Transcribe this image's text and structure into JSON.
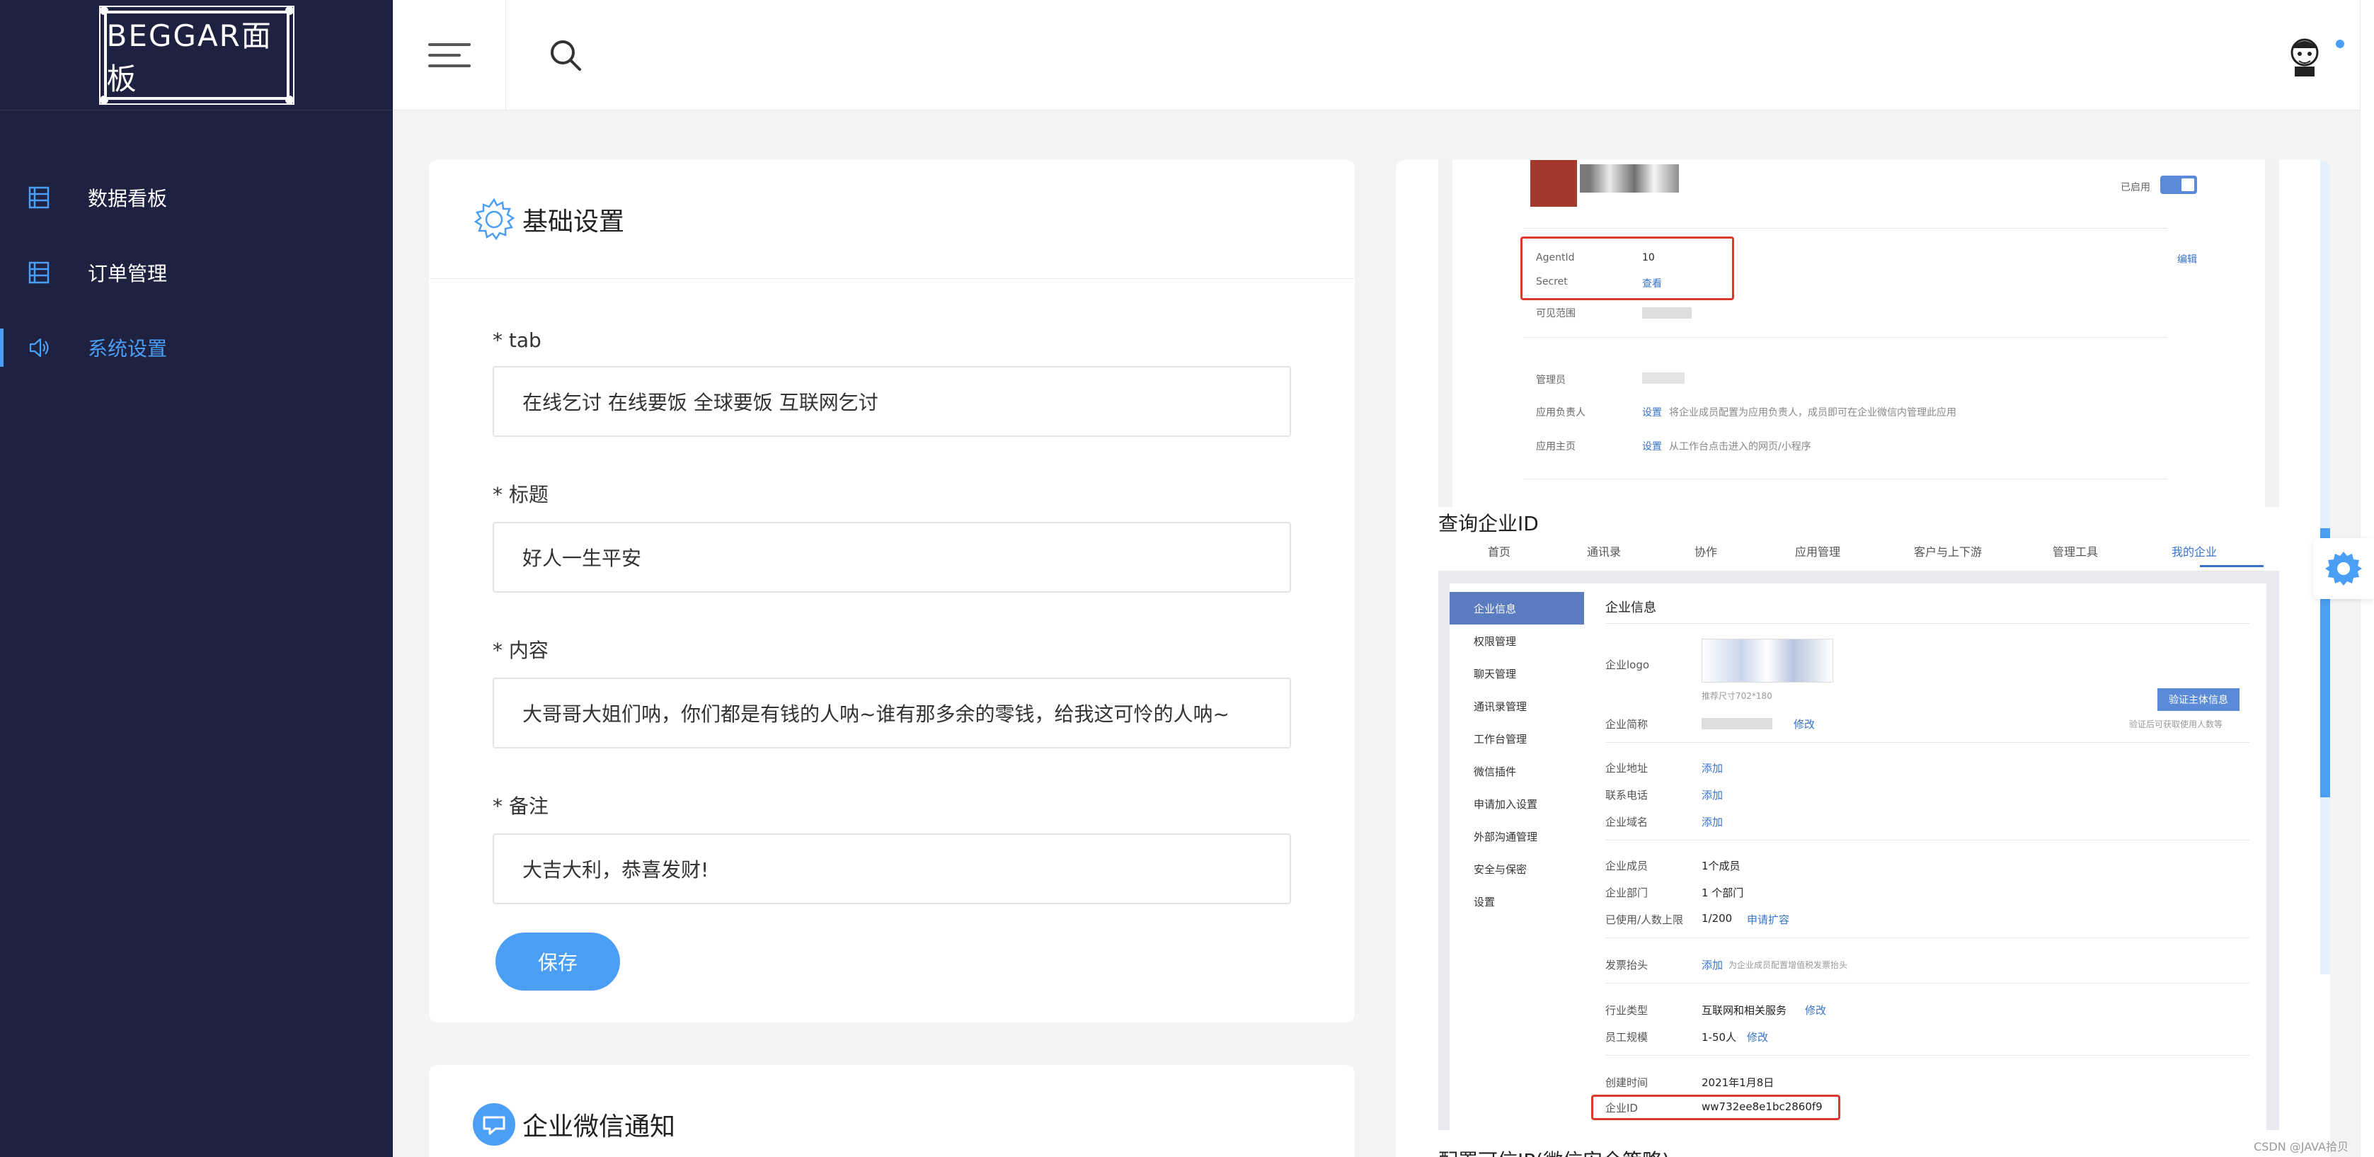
{
  "app": {
    "logo_text": "BEGGAR面板"
  },
  "sidebar": {
    "items": [
      {
        "label": "数据看板",
        "icon": "list-icon"
      },
      {
        "label": "订单管理",
        "icon": "list-icon"
      },
      {
        "label": "系统设置",
        "icon": "speaker-icon",
        "active": true
      }
    ]
  },
  "header": {
    "menu_icon": "hamburger-icon",
    "search_icon": "search-icon"
  },
  "basic_settings": {
    "title": "基础设置",
    "fields": [
      {
        "label": "* tab",
        "value": "在线乞讨 在线要饭 全球要饭 互联网乞讨"
      },
      {
        "label": "* 标题",
        "value": "好人一生平安"
      },
      {
        "label": "* 内容",
        "value": "大哥哥大姐们呐，你们都是有钱的人呐~谁有那多余的零钱，给我这可怜的人呐~"
      },
      {
        "label": "* 备注",
        "value": "大吉大利，恭喜发财!"
      }
    ],
    "save_label": "保存"
  },
  "wechat_card": {
    "title": "企业微信通知"
  },
  "doc": {
    "shot1": {
      "enabled_label": "已启用",
      "agentid_label": "AgentId",
      "agentid_value": "10",
      "secret_label": "Secret",
      "secret_link": "查看",
      "edit_link": "编辑",
      "visible_label": "可见范围",
      "admin_label": "管理员",
      "owner_label": "应用负责人",
      "owner_link": "设置",
      "owner_desc": "将企业成员配置为应用负责人，成员即可在企业微信内管理此应用",
      "home_label": "应用主页",
      "home_link": "设置",
      "home_desc": "从工作台点击进入的网页/小程序"
    },
    "section_title": "查询企业ID",
    "tabs": [
      "首页",
      "通讯录",
      "协作",
      "应用管理",
      "客户与上下游",
      "管理工具",
      "我的企业"
    ],
    "shot2": {
      "nav": [
        "企业信息",
        "权限管理",
        "聊天管理",
        "通讯录管理",
        "工作台管理",
        "微信插件",
        "申请加入设置",
        "外部沟通管理",
        "安全与保密",
        "设置"
      ],
      "heading": "企业信息",
      "logo_label": "企业logo",
      "logo_hint": "推荐尺寸702*180",
      "verify_btn": "验证主体信息",
      "verify_hint": "验证后可获取使用人数等",
      "short_name_label": "企业简称",
      "modify": "修改",
      "address_label": "企业地址",
      "phone_label": "联系电话",
      "domain_label": "企业域名",
      "add": "添加",
      "members_label": "企业成员",
      "members_value": "1个成员",
      "depts_label": "企业部门",
      "depts_value": "1 个部门",
      "used_label": "已使用/人数上限",
      "used_value": "1/200",
      "expand_link": "申请扩容",
      "invoice_label": "发票抬头",
      "invoice_desc": "为企业成员配置增值税发票抬头",
      "industry_label": "行业类型",
      "industry_value": "互联网和相关服务",
      "scale_label": "员工规模",
      "scale_value": "1-50人",
      "created_label": "创建时间",
      "created_value": "2021年1月8日",
      "corpid_label": "企业ID",
      "corpid_value": "ww732ee8e1bc2860f9"
    },
    "section_title2": "配置可信IP(微信安全策略)"
  },
  "watermark": "CSDN @JAVA拾贝",
  "colors": {
    "sidebar_bg": "#1f2140",
    "accent": "#4a9ff5",
    "highlight": "#d93a2b"
  }
}
